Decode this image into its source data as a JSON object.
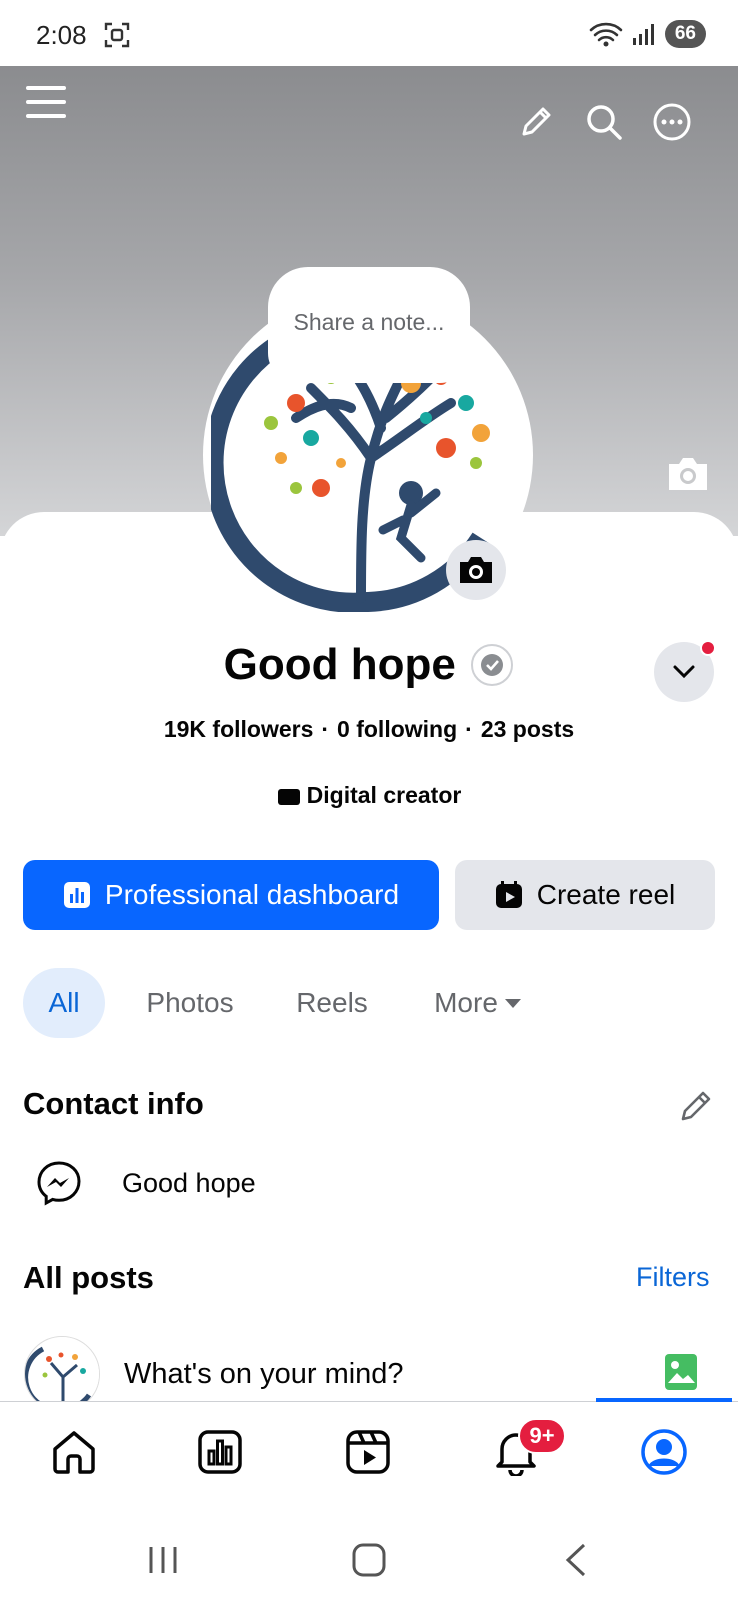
{
  "status_bar": {
    "time": "2:08",
    "battery": "66"
  },
  "profile": {
    "note_placeholder": "Share a note...",
    "name": "Good hope",
    "followers": "19K followers",
    "following": "0 following",
    "posts": "23 posts",
    "separator": "·",
    "category": "Digital creator"
  },
  "actions": {
    "primary_label": "Professional dashboard",
    "secondary_label": "Create reel"
  },
  "tabs": [
    {
      "label": "All",
      "active": true
    },
    {
      "label": "Photos"
    },
    {
      "label": "Reels"
    },
    {
      "label": "More"
    }
  ],
  "contact": {
    "title": "Contact info",
    "messenger_name": "Good hope"
  },
  "posts_section": {
    "title": "All posts",
    "filters_label": "Filters",
    "composer_placeholder": "What's on your mind?"
  },
  "bottom_nav": {
    "notifications_badge": "9+",
    "items": [
      "home-icon",
      "dashboard-icon",
      "reels-icon",
      "notifications-icon",
      "profile-icon"
    ],
    "accent": "#0866ff"
  }
}
